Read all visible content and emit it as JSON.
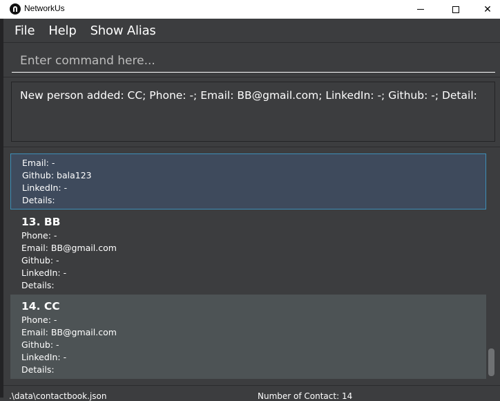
{
  "window": {
    "title": "NetworkUs",
    "close_glyph": "✕"
  },
  "menu": {
    "items": [
      "File",
      "Help",
      "Show Alias"
    ]
  },
  "command": {
    "placeholder": "Enter command here..."
  },
  "result": {
    "text": "New person added: CC; Phone: -; Email: BB@gmail.com; LinkedIn: -; Github: -; Detail:"
  },
  "persons": [
    {
      "name": "",
      "lines": [
        "Email: -",
        "Github: bala123",
        "LinkedIn: -",
        "Details:"
      ]
    },
    {
      "name": "13.  BB",
      "lines": [
        "Phone: -",
        "Email: BB@gmail.com",
        "Github: -",
        "LinkedIn: -",
        "Details:"
      ]
    },
    {
      "name": "14.  CC",
      "lines": [
        "Phone: -",
        "Email: BB@gmail.com",
        "Github: -",
        "LinkedIn: -",
        "Details:"
      ]
    }
  ],
  "status": {
    "path": ".\\data\\contactbook.json",
    "count": "Number of Contact: 14"
  },
  "colors": {
    "background": "#3c3d3f",
    "selected_card": "#3e4a5c",
    "selected_border": "#3e8fb8",
    "alt_card": "#4d5355"
  }
}
